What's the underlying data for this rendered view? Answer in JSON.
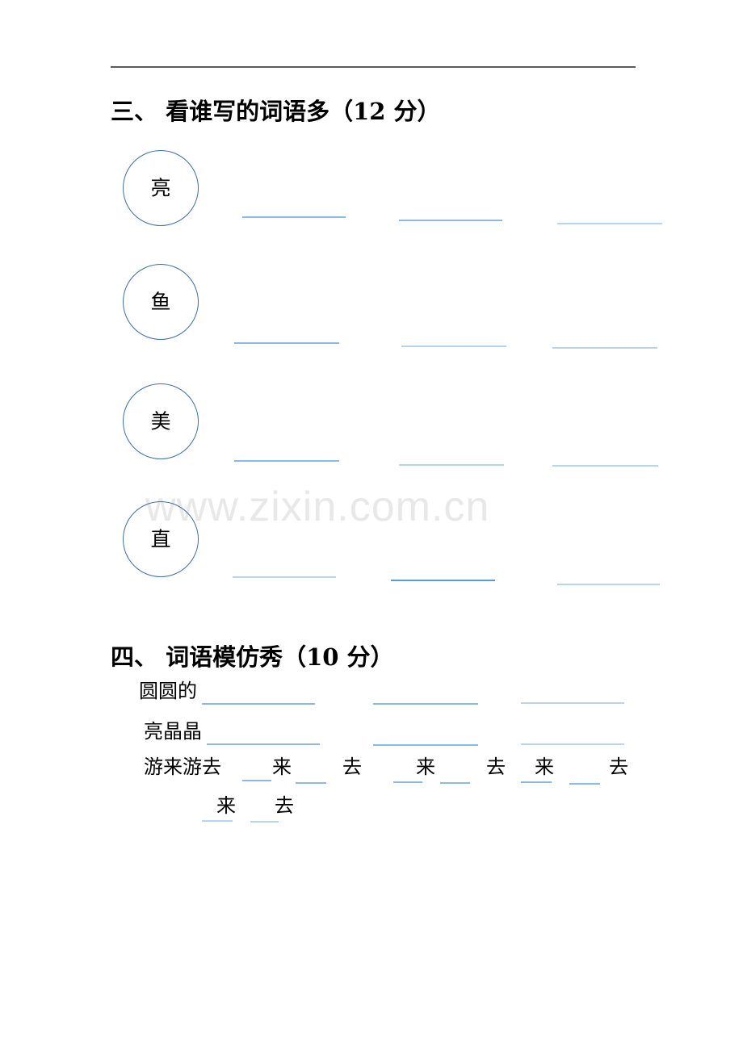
{
  "document": {
    "watermark": "www.zixin.com.cn"
  },
  "sections": [
    {
      "id": "section-three",
      "heading": "三、  看谁写的词语多（12 分）",
      "number": "三",
      "title": "看谁写的词语多",
      "points": "12 分",
      "items": [
        {
          "character": "亮",
          "blanks": 3
        },
        {
          "character": "鱼",
          "blanks": 3
        },
        {
          "character": "美",
          "blanks": 3
        },
        {
          "character": "直",
          "blanks": 3
        }
      ]
    },
    {
      "id": "section-four",
      "heading": "四、  词语模仿秀（10 分）",
      "number": "四",
      "title": "词语模仿秀",
      "points": "10 分",
      "rows": [
        {
          "label": "圆圆的",
          "blanks": 3
        },
        {
          "label": "亮晶晶",
          "blanks": 3
        },
        {
          "label": "游来游去",
          "pattern_groups": [
            {
              "a": "来",
              "b": "去"
            },
            {
              "a": "来",
              "b": "去"
            },
            {
              "a": "来",
              "b": "去"
            }
          ]
        },
        {
          "label": "",
          "pattern_groups": [
            {
              "a": "来",
              "b": "去"
            }
          ]
        }
      ]
    }
  ],
  "colors": {
    "circle_border": "#3d6fa5",
    "blank_line": "#8db9e2",
    "blank_line_dark": "#5b9bd5",
    "blank_line_pale": "#b9d5ee",
    "top_rule": "#595959",
    "watermark": "#e8e8e8"
  }
}
